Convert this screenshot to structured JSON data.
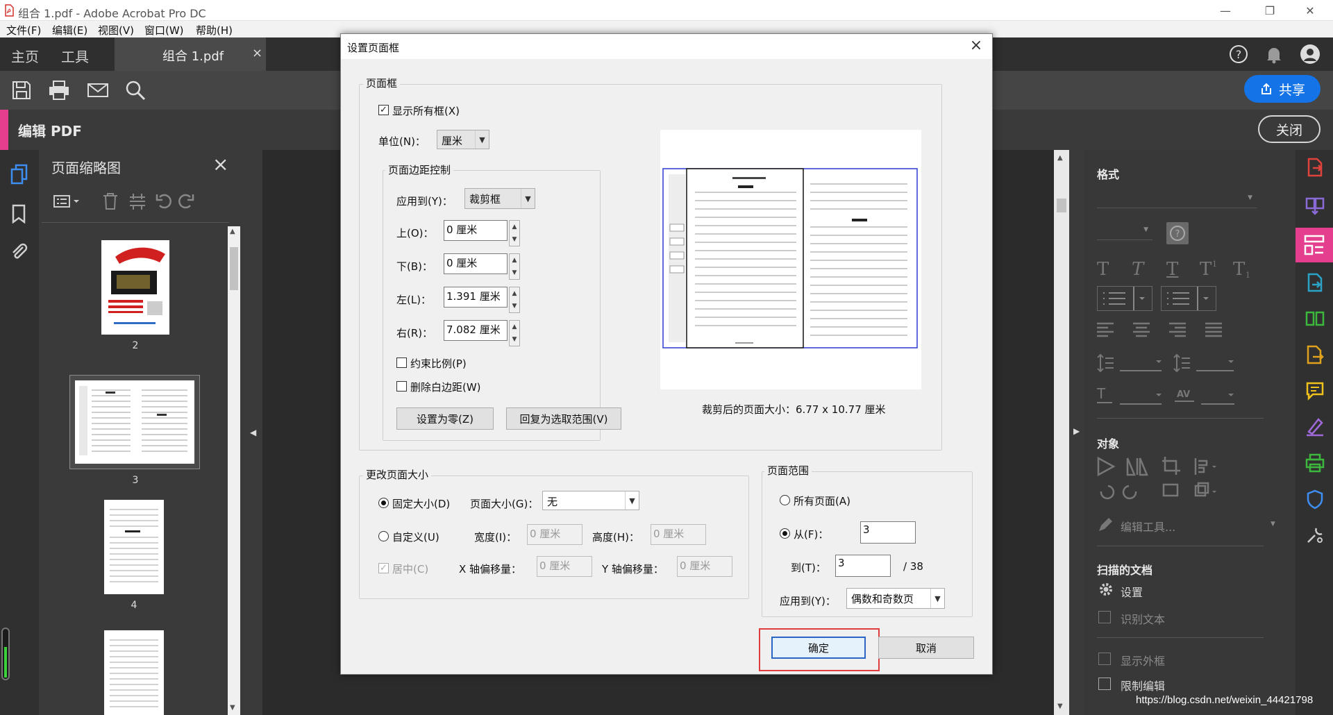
{
  "window": {
    "title": "组合 1.pdf - Adobe Acrobat Pro DC"
  },
  "menu": [
    "文件(F)",
    "编辑(E)",
    "视图(V)",
    "窗口(W)",
    "帮助(H)"
  ],
  "tabs": {
    "home": "主页",
    "tools": "工具",
    "doc": "组合 1.pdf",
    "doc_close": "×"
  },
  "toolbar": {
    "share": "共享"
  },
  "editbar": {
    "title": "编辑 PDF",
    "close": "关闭"
  },
  "thumbnails": {
    "title": "页面缩略图",
    "pages": [
      "2",
      "3",
      "4"
    ]
  },
  "rightpanel": {
    "format": "格式",
    "objects": "对象",
    "edit_tools": "编辑工具...",
    "scanned": "扫描的文档",
    "settings": "设置",
    "recognize": "识别文本",
    "show_bbox": "显示外框",
    "restrict": "限制编辑"
  },
  "watermark": "https://blog.csdn.net/weixin_44421798",
  "dialog": {
    "title": "设置页面框",
    "close": "×",
    "page_boxes": "页面框",
    "show_all": "显示所有框(X)",
    "unit_label": "单位(N)：",
    "unit_value": "厘米",
    "margin_group": "页面边距控制",
    "apply_to_label": "应用到(Y)：",
    "apply_to_value": "裁剪框",
    "top_label": "上(O)：",
    "top_value": "0 厘米",
    "bottom_label": "下(B)：",
    "bottom_value": "0 厘米",
    "left_label": "左(L)：",
    "left_value": "1.391 厘米",
    "right_label": "右(R)：",
    "right_value": "7.082 厘米",
    "constrain": "约束比例(P)",
    "remove_white": "删除白边距(W)",
    "set_zero": "设置为零(Z)",
    "revert": "回复为选取范围(V)",
    "cropped_size": "裁剪后的页面大小：6.77 x 10.77 厘米",
    "change_size": "更改页面大小",
    "fixed_size": "固定大小(D)",
    "page_size_label": "页面大小(G)：",
    "page_size_value": "无",
    "custom": "自定义(U)",
    "width_label": "宽度(I)：",
    "width_value": "0 厘米",
    "height_label": "高度(H)：",
    "height_value": "0 厘米",
    "center": "居中(C)",
    "x_offset_label": "X 轴偏移量：",
    "x_offset_value": "0 厘米",
    "y_offset_label": "Y 轴偏移量：",
    "y_offset_value": "0 厘米",
    "page_range": "页面范围",
    "all_pages": "所有页面(A)",
    "from_label": "从(F)：",
    "from_value": "3",
    "to_label": "到(T)：",
    "to_value": "3",
    "total": "/ 38",
    "range_apply_label": "应用到(Y)：",
    "range_apply_value": "偶数和奇数页",
    "ok": "确定",
    "cancel": "取消"
  },
  "colors": {
    "accent": "#1473e6",
    "edit_pink": "#e43f8f",
    "highlight": "#e23b3b"
  }
}
